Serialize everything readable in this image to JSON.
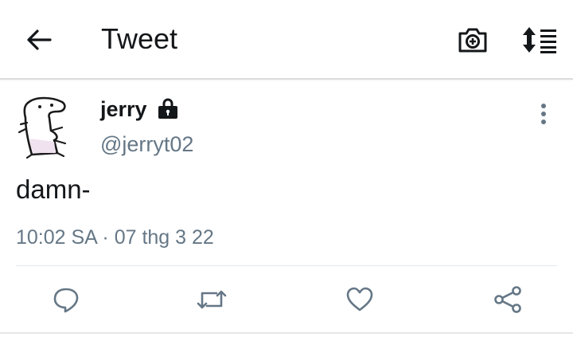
{
  "header": {
    "title": "Tweet",
    "icons": {
      "back": "arrow-left-icon",
      "camera": "camera-plus-icon",
      "sort": "sort-arrows-icon"
    }
  },
  "tweet": {
    "user": {
      "name": "jerry",
      "handle": "@jerryt02",
      "protected": true,
      "avatar": "hand-drawn-doodle-avatar"
    },
    "text": "damn-",
    "timestamp": "10:02 SA · 07 thg 3 22"
  },
  "actions": [
    "reply-icon",
    "retweet-icon",
    "like-icon",
    "share-icon"
  ],
  "colors": {
    "text": "#14171a",
    "secondary": "#657786",
    "icon": "#657786",
    "divider": "#e1e8ed"
  }
}
